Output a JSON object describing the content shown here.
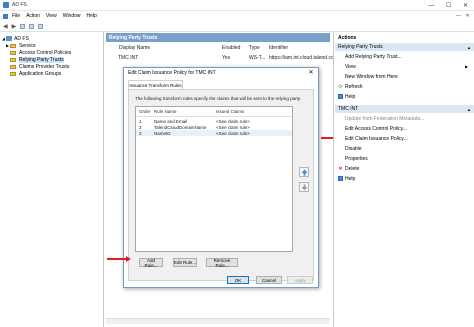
{
  "window": {
    "title": "AD FS",
    "controls": {
      "minimize": "—",
      "maximize": "☐",
      "close": "✕"
    }
  },
  "menu": [
    "File",
    "Action",
    "View",
    "Window",
    "Help"
  ],
  "tree": {
    "root": "AD FS",
    "items": [
      "Service",
      "Access Control Policies",
      "Relying Party Trusts",
      "Claims Provider Trusts",
      "Application Groups"
    ],
    "selected_index": 2
  },
  "middle": {
    "header": "Relying Party Trusts",
    "columns": [
      "Display Name",
      "Enabled",
      "Type",
      "Identifier"
    ],
    "row": {
      "name": "TMC INT",
      "enabled": "Yes",
      "type": "WS-T...",
      "identifier": "https://iam.int.cloud.talend.com/"
    }
  },
  "dialog": {
    "title": "Edit Claim Issuance Policy for TMC INT",
    "close": "✕",
    "tab": "Issuance Transform Rules",
    "description": "The following transform rules specify the claims that will be sent to the relying party.",
    "columns": [
      "Order",
      "Rule Name",
      "Issued Claims"
    ],
    "rules": [
      {
        "order": "1",
        "name": "Name and Email",
        "claims": "<See claim rule>"
      },
      {
        "order": "2",
        "name": "TalendCloudDomainName",
        "claims": "<See claim rule>"
      },
      {
        "order": "3",
        "name": "NameID",
        "claims": "<See claim rule>"
      }
    ],
    "selected_rule": 2,
    "buttons": {
      "add": "Add Rule...",
      "edit": "Edit Rule...",
      "remove": "Remove Rule...",
      "ok": "OK",
      "cancel": "Cancel",
      "apply": "Apply"
    }
  },
  "actions": {
    "header": "Actions",
    "section1": {
      "title": "Relying Party Trusts",
      "items": [
        "Add Relying Party Trust...",
        "View",
        "New Window from Here",
        "Refresh",
        "Help"
      ]
    },
    "section2": {
      "title": "TMC INT",
      "items": [
        "Update from Federation Metadata...",
        "Edit Access Control Policy...",
        "Edit Claim Issuance Policy...",
        "Disable",
        "Properties",
        "Delete",
        "Help"
      ]
    }
  },
  "colors": {
    "accent": "#7aa0c9",
    "arrow": "#e02020"
  }
}
